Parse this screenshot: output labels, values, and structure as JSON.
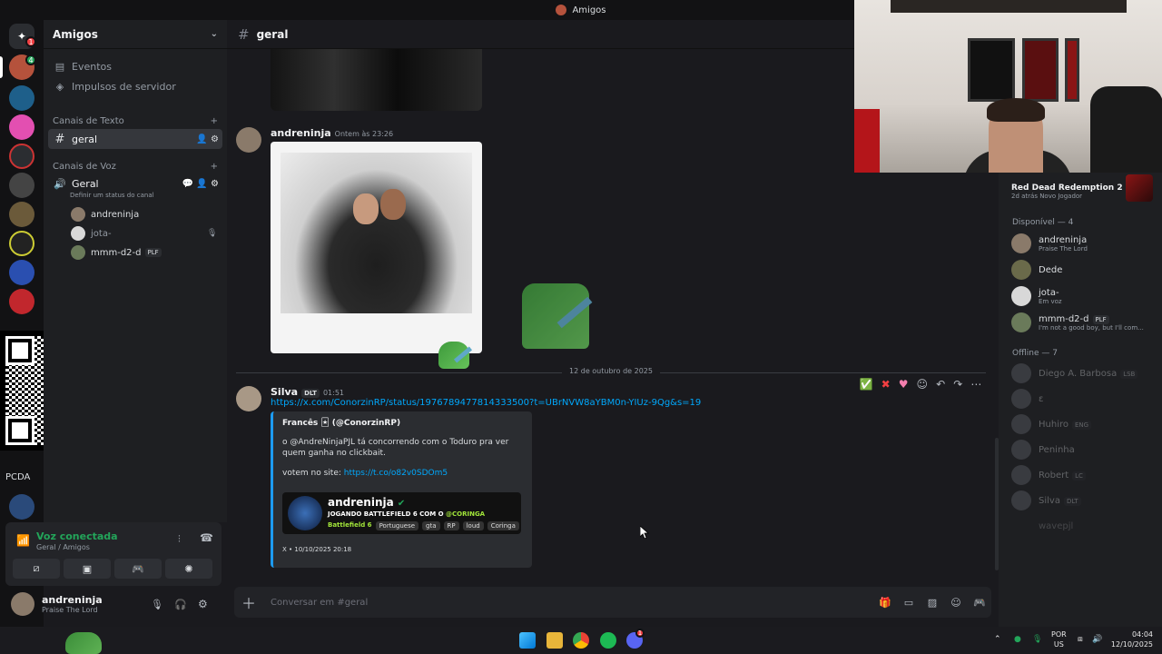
{
  "window": {
    "title": "Amigos"
  },
  "rail": {
    "home_badge": "1",
    "dm_badge": "4",
    "text_label_1": "PCDA"
  },
  "server": {
    "name": "Amigos",
    "events": "Eventos",
    "boosts": "Impulsos de servidor"
  },
  "text_category": {
    "label": "Canais de Texto"
  },
  "text_channels": [
    {
      "name": "geral"
    }
  ],
  "voice_category": {
    "label": "Canais de Voz"
  },
  "voice_channel": {
    "name": "Geral",
    "status_hint": "Definir um status do canal",
    "users": [
      {
        "name": "andreninja",
        "tag": ""
      },
      {
        "name": "jota-",
        "tag": ""
      },
      {
        "name": "mmm-d2-d",
        "tag": "PLF"
      }
    ]
  },
  "voice_panel": {
    "status": "Voz conectada",
    "location": "Geral / Amigos"
  },
  "user_panel": {
    "name": "andreninja",
    "status": "Praise The Lord"
  },
  "chat": {
    "channel": "geral",
    "messages": [
      {
        "author": "andreninja",
        "time": "Ontem às 23:26"
      },
      {
        "author": "Silva",
        "badge": "DLT",
        "time": "01:51",
        "link": "https://x.com/ConorzinRP/status/1976789477814333500?t=UBrNVW8aYBM0n-YIUz-9Qg&s=19"
      }
    ],
    "day_divider": "12 de outubro de 2025",
    "embed": {
      "author": "Francês 🃏 (@ConorzinRP)",
      "text_1": "o @AndreNinjaPJL tá concorrendo com o Toduro pra ver quem ganha no clickbait.",
      "text_2_prefix": "votem no site: ",
      "text_2_link": "https://t.co/o82v0SDOm5",
      "card_name": "andreninja",
      "card_title_prefix": "JOGANDO BATTLEFIELD 6 COM O ",
      "card_title_highlight": "@CORINGA",
      "card_game": "Battlefield 6",
      "card_tags": [
        "Portuguese",
        "gta",
        "RP",
        "loud",
        "Coringa"
      ],
      "footer": "X • 10/10/2025 20:18"
    },
    "input_placeholder": "Conversar em #geral"
  },
  "members": {
    "activity": {
      "game": "Red Dead Redemption 2",
      "sub": "2d atrás   Novo Jogador"
    },
    "online_header": "Disponível — 4",
    "online": [
      {
        "name": "andreninja",
        "status": "Praise The Lord",
        "tag": ""
      },
      {
        "name": "Dede",
        "status": "",
        "tag": ""
      },
      {
        "name": "jota-",
        "status": "Em voz",
        "tag": ""
      },
      {
        "name": "mmm-d2-d",
        "status": "I'm not a good boy, but I'll com...",
        "tag": "PLF"
      }
    ],
    "offline_header": "Offline — 7",
    "offline": [
      {
        "name": "Diego A. Barbosa",
        "tag": "LSB"
      },
      {
        "name": "ε",
        "tag": ""
      },
      {
        "name": "Huhiro",
        "tag": "ENG"
      },
      {
        "name": "Peninha",
        "tag": ""
      },
      {
        "name": "Robert",
        "tag": "LC"
      },
      {
        "name": "Silva",
        "tag": "DLT"
      },
      {
        "name": "wavepjl",
        "tag": ""
      }
    ]
  },
  "taskbar": {
    "lang_1": "POR",
    "lang_2": "US",
    "time": "04:04",
    "date": "12/10/2025",
    "discord_badge": "1"
  },
  "colors": {
    "accent_green": "#23a55a",
    "link": "#00a8fc",
    "danger": "#f23f42"
  }
}
